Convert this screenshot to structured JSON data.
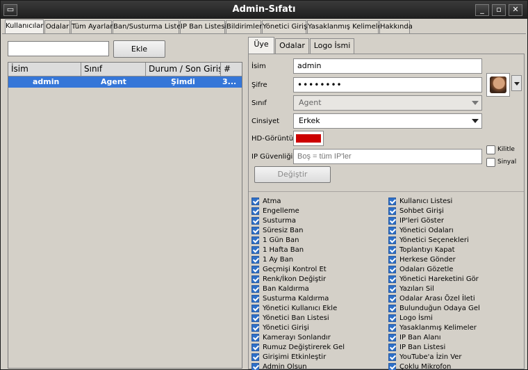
{
  "window": {
    "title": "Admin-Sıfatı"
  },
  "top_tabs": [
    {
      "label": "Kullanıcılar",
      "active": true
    },
    {
      "label": "Odalar"
    },
    {
      "label": "Tüm Ayarlar"
    },
    {
      "label": "Ban/Susturma Listesi"
    },
    {
      "label": "IP Ban Listesi"
    },
    {
      "label": "Bildirimler"
    },
    {
      "label": "Yönetici Girişi"
    },
    {
      "label": "Yasaklanmış Kelimeler"
    },
    {
      "label": "Hakkında"
    }
  ],
  "user_list": {
    "search_value": "",
    "add_label": "Ekle",
    "columns": [
      "İsim",
      "Sınıf",
      "Durum / Son Giriş",
      "#"
    ],
    "rows": [
      {
        "name": "admin",
        "class": "Agent",
        "status": "Şimdi",
        "num": "3..."
      }
    ]
  },
  "right_tabs": [
    {
      "label": "Üye",
      "active": true
    },
    {
      "label": "Odalar"
    },
    {
      "label": "Logo İsmi"
    }
  ],
  "form": {
    "name_label": "İsim",
    "name_value": "admin",
    "password_label": "Şifre",
    "password_value": "••••••••",
    "class_label": "Sınıf",
    "class_value": "Agent",
    "gender_label": "Cinsiyet",
    "gender_value": "Erkek",
    "hd_label": "HD-Görüntü",
    "hd_color": "#cc0000",
    "ip_label": "IP Güvenliği",
    "ip_placeholder": "Boş = tüm IP'ler",
    "lock_label": "Kilitle",
    "signal_label": "Sinyal",
    "lock_checked": false,
    "signal_checked": false,
    "change_label": "Değiştir"
  },
  "permissions_left": [
    "Atma",
    "Engelleme",
    "Susturma",
    "Süresiz Ban",
    "1 Gün Ban",
    "1 Hafta Ban",
    "1 Ay Ban",
    "Geçmişi Kontrol Et",
    "Renk/İkon Değiştir",
    "Ban Kaldırma",
    "Susturma Kaldırma",
    "Yönetici Kullanıcı Ekle",
    "Yönetici Ban Listesi",
    "Yönetici Girişi",
    "Kamerayı Sonlandır",
    "Rumuz Değiştirerek Gel",
    "Girişimi Etkinleştir",
    "Admin Olsun"
  ],
  "permissions_right": [
    "Kullanıcı Listesi",
    "Sohbet Girişi",
    "IP'leri Göster",
    "Yönetici Odaları",
    "Yönetici Seçenekleri",
    "Toplantıyı Kapat",
    "Herkese Gönder",
    "Odaları Gözetle",
    "Yönetici Hareketini Gör",
    "Yazıları Sil",
    "Odalar Arası Özel İleti",
    "Bulunduğun Odaya Gel",
    "Logo İsmi",
    "Yasaklanmış Kelimeler",
    "IP Ban Alanı",
    "IP Ban Listesi",
    "YouTube'a İzin Ver",
    "Çoklu Mikrofon"
  ],
  "colors": {
    "selection": "#3576d8",
    "checkbox": "#2e70c8",
    "titlebar": "#262626"
  }
}
